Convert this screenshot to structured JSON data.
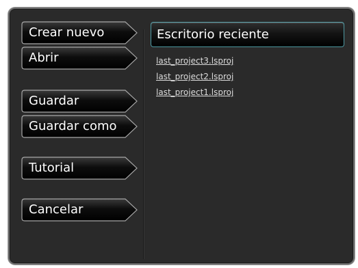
{
  "menu": {
    "items": [
      {
        "id": "new",
        "label": "Crear nuevo"
      },
      {
        "id": "open",
        "label": "Abrir"
      },
      {
        "id": "save",
        "label": "Guardar"
      },
      {
        "id": "save-as",
        "label": "Guardar como"
      },
      {
        "id": "tutorial",
        "label": "Tutorial"
      },
      {
        "id": "cancel",
        "label": "Cancelar"
      }
    ]
  },
  "recent": {
    "title": "Escritorio reciente",
    "files": [
      "last_project3.lsproj",
      "last_project2.lsproj",
      "last_project1.lsproj"
    ]
  },
  "colors": {
    "dialog_background": "#2a2a2a",
    "button_background": "#000000",
    "header_border": "#4e9aa3",
    "link_text": "#dcdcdc"
  }
}
